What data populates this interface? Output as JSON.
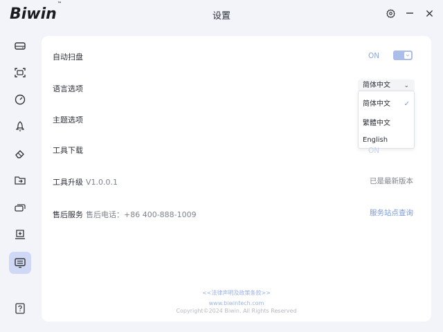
{
  "app": {
    "logo_text": "Biwin",
    "logo_tm": "™",
    "window_title": "设置"
  },
  "window_controls": [
    "settings-icon",
    "minimize-icon",
    "close-icon"
  ],
  "sidebar": {
    "items": [
      {
        "name": "disk-info",
        "icon": "drive-icon"
      },
      {
        "name": "scan",
        "icon": "scan-icon"
      },
      {
        "name": "speed-test",
        "icon": "gauge-icon"
      },
      {
        "name": "optimize",
        "icon": "rocket-icon"
      },
      {
        "name": "erase",
        "icon": "eraser-icon"
      },
      {
        "name": "migration",
        "icon": "folder-transfer-icon"
      },
      {
        "name": "clone",
        "icon": "disk-clone-icon"
      },
      {
        "name": "firmware",
        "icon": "firmware-icon"
      },
      {
        "name": "settings",
        "icon": "monitor-list-icon",
        "active": true
      },
      {
        "name": "help",
        "icon": "question-icon"
      }
    ]
  },
  "settings": {
    "auto_scan": {
      "label": "自动扫盘",
      "state": "ON"
    },
    "language": {
      "label": "语言选项",
      "selected": "简体中文",
      "options": [
        "简体中文",
        "繁體中文",
        "English"
      ]
    },
    "theme": {
      "label": "主题选项"
    },
    "tool_download": {
      "label": "工具下载",
      "state": "ON"
    },
    "tool_upgrade": {
      "label": "工具升级",
      "version": "V1.0.0.1",
      "status": "已是最新版本"
    },
    "after_sales": {
      "label": "售后服务",
      "phone": "售后电话：+86 400-888-1009",
      "link": "服务站点查询"
    }
  },
  "footer": {
    "legal": "<<法律声明及政策条款>>",
    "website": "www.biwintech.com",
    "copyright": "Copyright©2024 Biwin. All Rights Reserved"
  },
  "colors": {
    "accent": "#7899e0",
    "toggle": "#aabee9",
    "active_nav": "#cfd9f5",
    "background": "#f2f4f9"
  }
}
